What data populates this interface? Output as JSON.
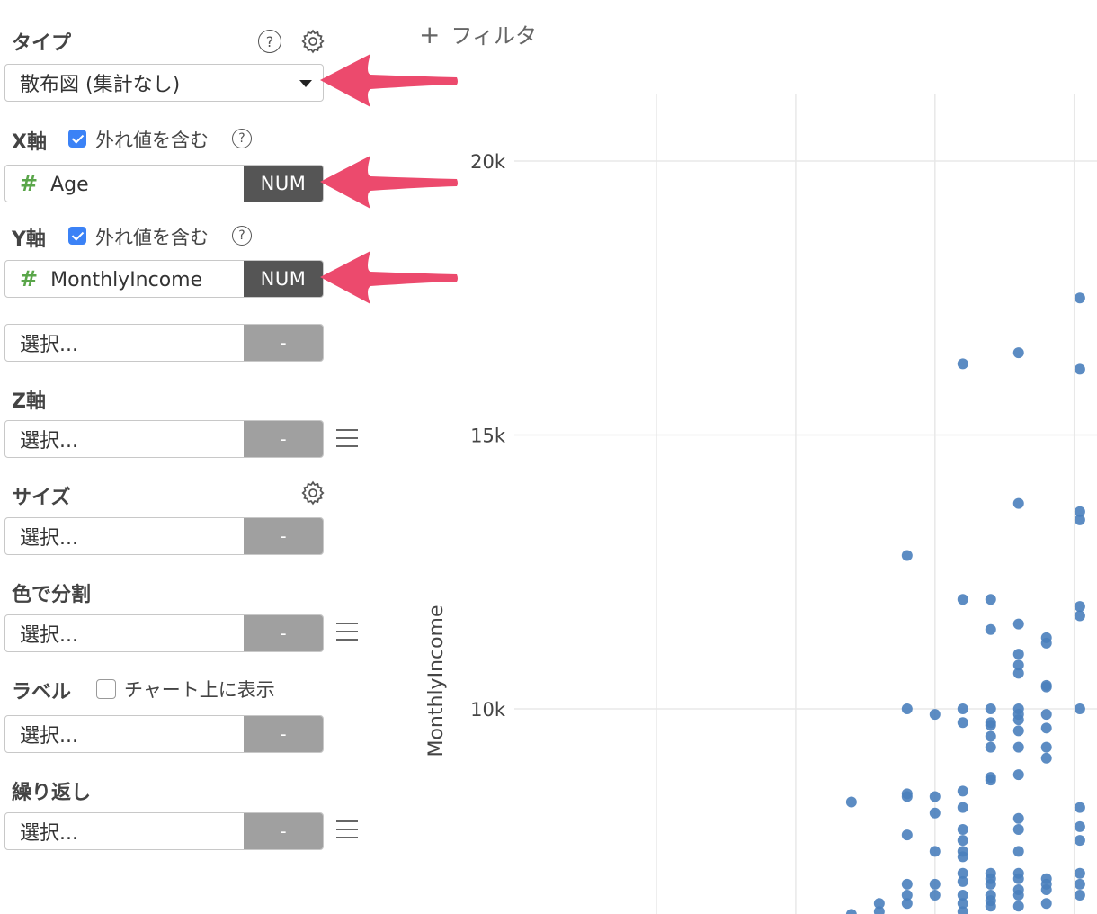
{
  "panel": {
    "type_section": {
      "label": "タイプ",
      "help": "?",
      "select_value": "散布図 (集計なし)"
    },
    "x_axis": {
      "label": "X軸",
      "include_outliers": {
        "checked": true,
        "label": "外れ値を含む"
      },
      "help": "?",
      "field_icon": "#",
      "field_value": "Age",
      "field_type": "NUM"
    },
    "y_axis": {
      "label": "Y軸",
      "include_outliers": {
        "checked": true,
        "label": "外れ値を含む"
      },
      "help": "?",
      "field_icon": "#",
      "field_value": "MonthlyIncome",
      "field_type": "NUM"
    },
    "y_axis_second": {
      "placeholder": "選択...",
      "type": "-"
    },
    "z_axis": {
      "label": "Z軸",
      "placeholder": "選択...",
      "type": "-"
    },
    "size": {
      "label": "サイズ",
      "placeholder": "選択...",
      "type": "-"
    },
    "color_split": {
      "label": "色で分割",
      "placeholder": "選択...",
      "type": "-"
    },
    "label": {
      "label": "ラベル",
      "show_on_chart": {
        "checked": false,
        "label": "チャート上に表示"
      },
      "placeholder": "選択...",
      "type": "-"
    },
    "repeat": {
      "label": "繰り返し",
      "placeholder": "選択...",
      "type": "-"
    }
  },
  "filter": {
    "plus": "+",
    "label": "フィルタ"
  },
  "colors": {
    "point": "#4a7fbd",
    "arrow": "#ec4a6d",
    "grid": "#e8e8e8",
    "check": "#3b82f6"
  },
  "chart_data": {
    "type": "scatter",
    "ylabel": "MonthlyIncome",
    "y_ticks": [
      {
        "value": 10000,
        "label": "10k"
      },
      {
        "value": 15000,
        "label": "15k"
      },
      {
        "value": 20000,
        "label": "20k"
      }
    ],
    "x_grid": [
      37,
      42,
      47,
      52
    ],
    "x_visible_range": [
      37,
      52.3
    ],
    "y_visible_range": [
      6270,
      20490
    ],
    "points": [
      [
        52.2,
        17500
      ],
      [
        52.2,
        16200
      ],
      [
        52.2,
        13600
      ],
      [
        52.2,
        13450
      ],
      [
        52.2,
        11870
      ],
      [
        52.2,
        11700
      ],
      [
        52.2,
        10000
      ],
      [
        52.2,
        8200
      ],
      [
        52.2,
        7850
      ],
      [
        52.2,
        7600
      ],
      [
        52.2,
        7000
      ],
      [
        52.2,
        6800
      ],
      [
        52.2,
        6600
      ],
      [
        50,
        16500
      ],
      [
        50,
        13750
      ],
      [
        50,
        11550
      ],
      [
        50,
        11000
      ],
      [
        50,
        10800
      ],
      [
        50,
        10650
      ],
      [
        50,
        10000
      ],
      [
        50,
        9900
      ],
      [
        50,
        9800
      ],
      [
        50,
        9600
      ],
      [
        50,
        9300
      ],
      [
        50,
        8800
      ],
      [
        50,
        8000
      ],
      [
        50,
        7800
      ],
      [
        50,
        7400
      ],
      [
        50,
        7000
      ],
      [
        50,
        6900
      ],
      [
        50,
        6700
      ],
      [
        50,
        6600
      ],
      [
        50,
        6400
      ],
      [
        51,
        11300
      ],
      [
        51,
        11200
      ],
      [
        51,
        10430
      ],
      [
        51,
        10400
      ],
      [
        51,
        9900
      ],
      [
        51,
        9650
      ],
      [
        51,
        9300
      ],
      [
        51,
        9100
      ],
      [
        51,
        6900
      ],
      [
        51,
        6800
      ],
      [
        51,
        6700
      ],
      [
        51,
        6450
      ],
      [
        49,
        12000
      ],
      [
        49,
        11450
      ],
      [
        49,
        10000
      ],
      [
        49,
        9750
      ],
      [
        49,
        9700
      ],
      [
        49,
        9500
      ],
      [
        49,
        9300
      ],
      [
        49,
        8750
      ],
      [
        49,
        8700
      ],
      [
        49,
        7000
      ],
      [
        49,
        6900
      ],
      [
        49,
        6800
      ],
      [
        49,
        6600
      ],
      [
        49,
        6500
      ],
      [
        49,
        6400
      ],
      [
        48,
        16300
      ],
      [
        48,
        12000
      ],
      [
        48,
        10000
      ],
      [
        48,
        9750
      ],
      [
        48,
        8500
      ],
      [
        48,
        8200
      ],
      [
        48,
        7800
      ],
      [
        48,
        7600
      ],
      [
        48,
        7400
      ],
      [
        48,
        7300
      ],
      [
        48,
        7000
      ],
      [
        48,
        6850
      ],
      [
        48,
        6600
      ],
      [
        48,
        6450
      ],
      [
        48,
        6300
      ],
      [
        47,
        9900
      ],
      [
        47,
        8400
      ],
      [
        47,
        8100
      ],
      [
        47,
        7400
      ],
      [
        47,
        6800
      ],
      [
        47,
        6600
      ],
      [
        46,
        12800
      ],
      [
        46,
        10000
      ],
      [
        46,
        8450
      ],
      [
        46,
        8400
      ],
      [
        46,
        7700
      ],
      [
        46,
        6800
      ],
      [
        46,
        6600
      ],
      [
        46,
        6450
      ],
      [
        45,
        6450
      ],
      [
        45,
        6300
      ],
      [
        44,
        8300
      ],
      [
        44,
        6250
      ]
    ]
  }
}
